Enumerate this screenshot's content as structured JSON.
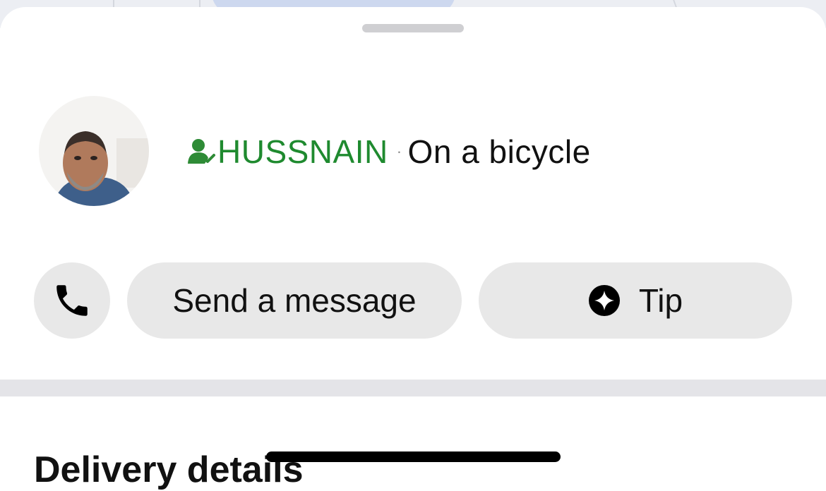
{
  "driver": {
    "name": "HUSSNAIN",
    "separator": "·",
    "vehicle": "On a bicycle",
    "name_color": "#1f8a2f",
    "verified_icon": "verified-person-icon",
    "avatar": "driver-photo"
  },
  "actions": {
    "call_icon": "phone-icon",
    "message_label": "Send a message",
    "tip_icon": "sparkle-icon",
    "tip_label": "Tip"
  },
  "section": {
    "title": "Delivery details"
  }
}
